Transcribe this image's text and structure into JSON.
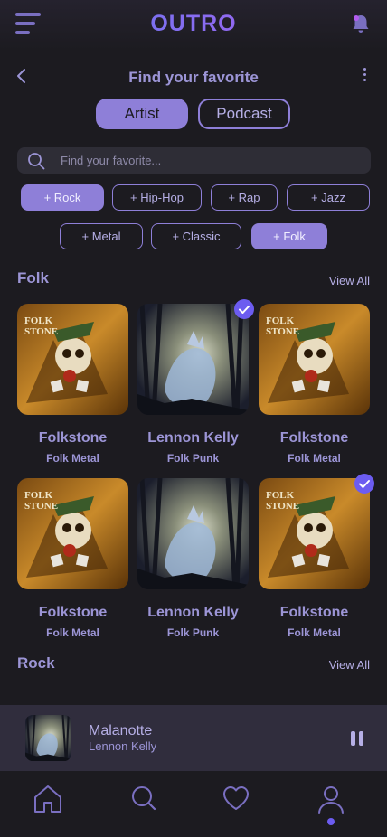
{
  "app": {
    "logo": "OUTRO"
  },
  "header": {
    "title": "Find your favorite"
  },
  "segments": [
    {
      "label": "Artist",
      "active": true
    },
    {
      "label": "Podcast",
      "active": false
    }
  ],
  "search": {
    "placeholder": "Find your favorite..."
  },
  "genres": [
    {
      "label": "+ Rock",
      "selected": true
    },
    {
      "label": "+ Hip-Hop",
      "selected": false
    },
    {
      "label": "+ Rap",
      "selected": false
    },
    {
      "label": "+ Jazz",
      "selected": false
    },
    {
      "label": "+ Metal",
      "selected": false
    },
    {
      "label": "+ Classic",
      "selected": false
    },
    {
      "label": "+ Folk",
      "selected": true
    }
  ],
  "sections": [
    {
      "title": "Folk",
      "view_all": "View All",
      "artists": [
        {
          "name": "Folkstone",
          "genre": "Folk Metal",
          "selected": false,
          "art": "folkstone-cover"
        },
        {
          "name": "Lennon Kelly",
          "genre": "Folk Punk",
          "selected": true,
          "art": "lennon-kelly-cover"
        },
        {
          "name": "Folkstone",
          "genre": "Folk Metal",
          "selected": false,
          "art": "folkstone-cover"
        },
        {
          "name": "Folkstone",
          "genre": "Folk Metal",
          "selected": false,
          "art": "folkstone-cover"
        },
        {
          "name": "Lennon Kelly",
          "genre": "Folk Punk",
          "selected": false,
          "art": "lennon-kelly-cover"
        },
        {
          "name": "Folkstone",
          "genre": "Folk Metal",
          "selected": true,
          "art": "folkstone-cover"
        }
      ]
    },
    {
      "title": "Rock",
      "view_all": "View All",
      "artists": []
    }
  ],
  "now_playing": {
    "title": "Malanotte",
    "artist": "Lennon Kelly",
    "state": "playing"
  },
  "tabs": [
    {
      "icon": "home-icon",
      "active": false
    },
    {
      "icon": "search-icon",
      "active": false
    },
    {
      "icon": "heart-icon",
      "active": false
    },
    {
      "icon": "profile-icon",
      "active": true
    }
  ],
  "colors": {
    "accent": "#8e7fd8",
    "background": "#1c1b20",
    "check": "#6c5cf0"
  }
}
